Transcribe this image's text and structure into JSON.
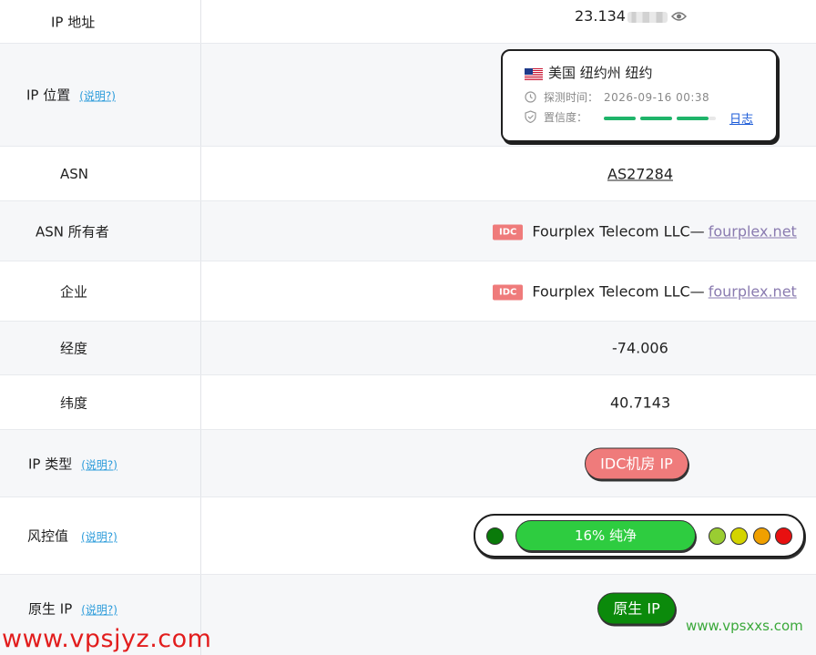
{
  "rows": {
    "ip": {
      "label": "IP 地址",
      "value": "23.134"
    },
    "location": {
      "label": "IP 位置",
      "help": "(说明?)",
      "place": "美国 纽约州 纽约",
      "detect_label": "探测时间：",
      "detect_time": "2026-09-16 00:38",
      "confidence_label": "置信度：",
      "confidence_level": 0.75,
      "log_link": "日志"
    },
    "asn": {
      "label": "ASN",
      "value": "AS27284"
    },
    "asn_owner": {
      "label": "ASN 所有者",
      "tag": "IDC",
      "name": "Fourplex Telecom LLC—",
      "domain": "fourplex.net"
    },
    "company": {
      "label": "企业",
      "tag": "IDC",
      "name": "Fourplex Telecom LLC—",
      "domain": "fourplex.net"
    },
    "longitude": {
      "label": "经度",
      "value": "-74.006"
    },
    "latitude": {
      "label": "纬度",
      "value": "40.7143"
    },
    "ip_type": {
      "label": "IP 类型",
      "help": "(说明?)",
      "badge": "IDC机房 IP"
    },
    "risk": {
      "label": "风控值",
      "help": "(说明?)",
      "bar_text": "16%   纯净",
      "percent": 16
    },
    "native_ip": {
      "label": "原生 IP",
      "help": "(说明?)",
      "badge": "原生 IP"
    }
  },
  "colors": {
    "idc_tag": "#ef7b7b",
    "risk_pure": "#2ecc40",
    "native_badge": "#0b8a0b",
    "type_badge": "#ef7b7b",
    "risk_dots": [
      "#0a7a0a",
      "#9acd32",
      "#d4d400",
      "#f0a000",
      "#e81010"
    ]
  },
  "icons": [
    "flag-us-icon",
    "clock-icon",
    "shield-check-icon",
    "eye-icon"
  ],
  "watermarks": {
    "left": "www.vpsjyz.com",
    "right": "www.vpsxxs.com"
  }
}
